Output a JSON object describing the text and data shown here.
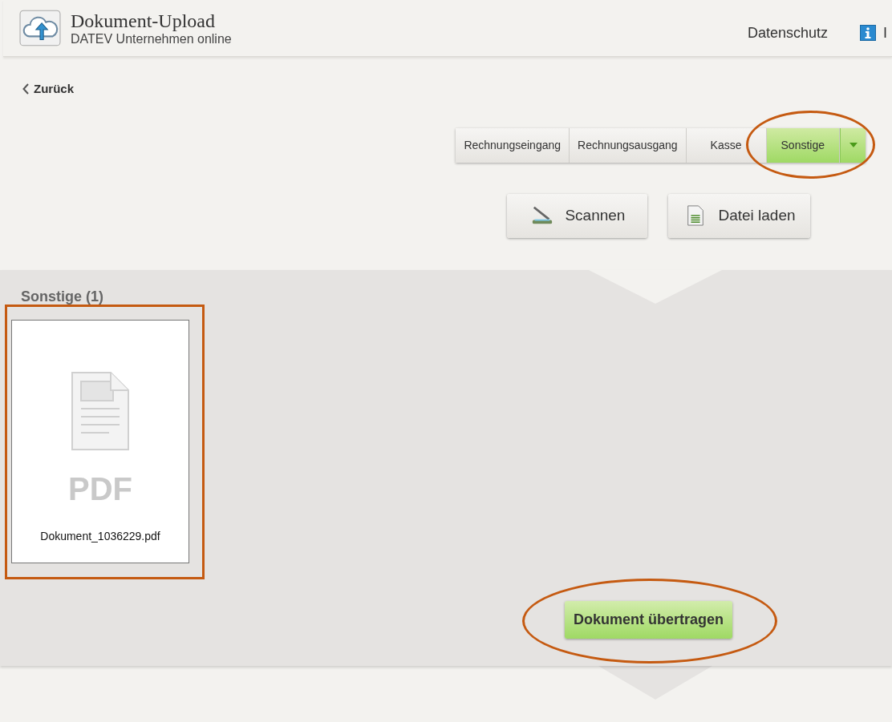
{
  "header": {
    "title": "Dokument-Upload",
    "subtitle": "DATEV Unternehmen online",
    "links": [
      {
        "label": "Datenschutz",
        "kind": "text"
      },
      {
        "label": "I",
        "kind": "info"
      }
    ]
  },
  "back_link": "Zurück",
  "document_types": {
    "highlighted": true,
    "items": [
      {
        "label": "Rechnungseingang",
        "selected": false
      },
      {
        "label": "Rechnungsausgang",
        "selected": false
      },
      {
        "label": "Kasse",
        "selected": false
      },
      {
        "label": "Sonstige",
        "selected": true
      }
    ]
  },
  "actions": [
    {
      "label": "Scannen",
      "kind": "scan"
    },
    {
      "label": "Datei laden",
      "kind": "file"
    }
  ],
  "section": {
    "title": "Sonstige (1)",
    "documents": [
      {
        "file_type": "PDF",
        "filename": "Dokument_1036229.pdf",
        "highlighted": true
      }
    ]
  },
  "transfer_button": {
    "label": "Dokument übertragen",
    "highlighted": true
  }
}
